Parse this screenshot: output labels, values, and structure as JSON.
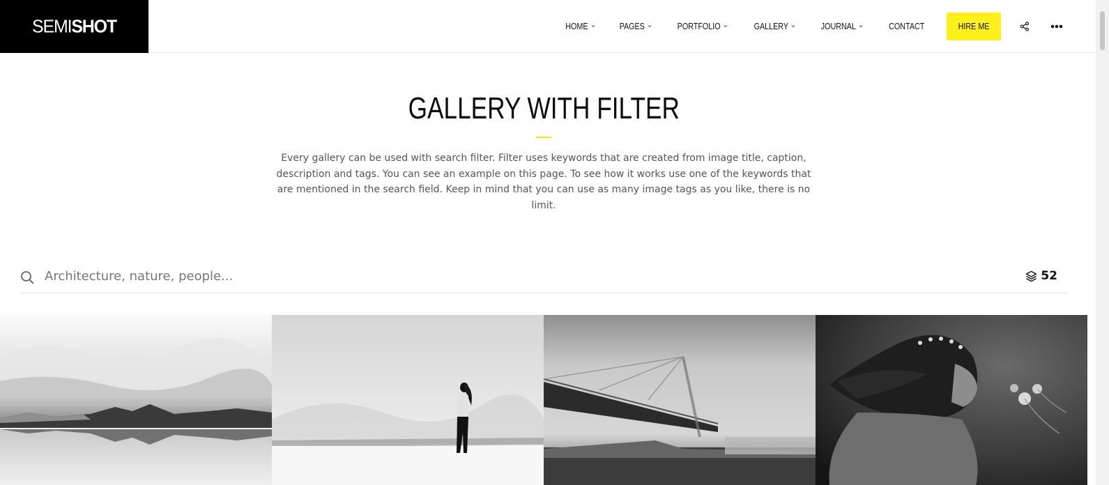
{
  "brand": {
    "logo_part1": "SEMI",
    "logo_part2": "SHOT"
  },
  "nav": {
    "items": [
      {
        "label": "HOME",
        "has_dropdown": true
      },
      {
        "label": "PAGES",
        "has_dropdown": true
      },
      {
        "label": "PORTFOLIO",
        "has_dropdown": true
      },
      {
        "label": "GALLERY",
        "has_dropdown": true
      },
      {
        "label": "JOURNAL",
        "has_dropdown": true
      },
      {
        "label": "CONTACT",
        "has_dropdown": false
      }
    ],
    "cta_label": "HIRE ME",
    "icons": [
      "share-icon",
      "more-icon"
    ]
  },
  "page": {
    "title": "GALLERY WITH FILTER",
    "description": "Every gallery can be used with search filter. Filter uses keywords that are created from image title, caption, description and tags. You can see an example on this page. To see how it works use one of the keywords that are mentioned in the search field. Keep in mind that you can use as many image tags as you like, there is no limit."
  },
  "search": {
    "placeholder": "Architecture, nature, people...",
    "value": "",
    "count": "52"
  },
  "gallery": {
    "images": [
      {
        "subject": "mountain-lake"
      },
      {
        "subject": "woman-in-snow"
      },
      {
        "subject": "bridge-in-fog"
      },
      {
        "subject": "girl-with-flowers"
      }
    ]
  },
  "colors": {
    "accent": "#ffef1b",
    "logo_bg": "#000000"
  }
}
